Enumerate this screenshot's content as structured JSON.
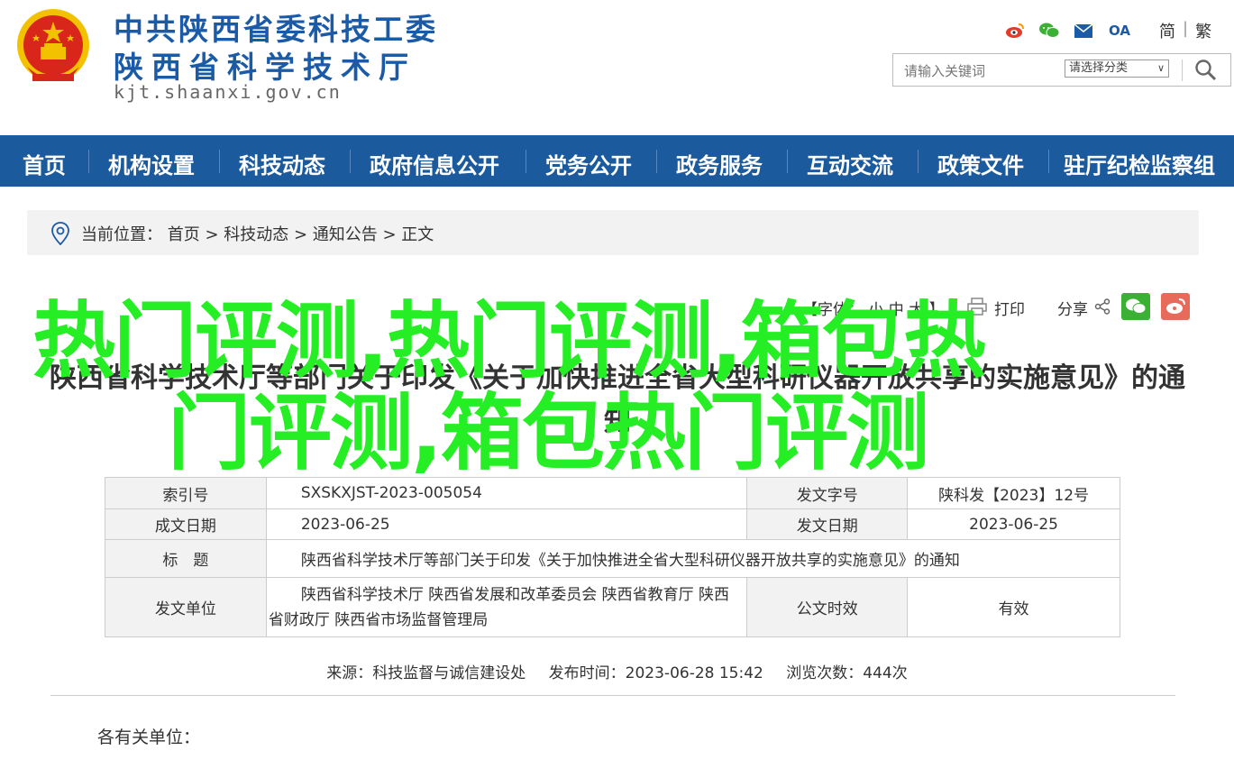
{
  "header": {
    "title_line1": "中共陕西省委科技工委",
    "title_line2": "陕西省科学技术厅",
    "domain": "kjt.shaanxi.gov.cn",
    "icons": [
      "weibo-icon",
      "wechat-icon",
      "mail-icon",
      "oa-icon"
    ],
    "oa_label": "OA",
    "lang_simplified": "简",
    "lang_separator": "|",
    "lang_traditional": "繁",
    "search_placeholder": "请输入关键词",
    "category_select": "请选择分类",
    "colors": {
      "brand_blue": "#1b5aa6",
      "emblem_red": "#d8261b",
      "emblem_gold": "#f2c200"
    }
  },
  "nav": {
    "items": [
      "首页",
      "机构设置",
      "科技动态",
      "政府信息公开",
      "党务公开",
      "政务服务",
      "互动交流",
      "政策文件",
      "驻厅纪检监察组"
    ],
    "background": "#1c5a9e"
  },
  "breadcrumb": {
    "text": "当前位置： 首页 > 科技动态 > 通知公告 > 正文"
  },
  "tools": {
    "font_size": "【字体： 小  中  大 】",
    "print": "打印",
    "share": "分享"
  },
  "article": {
    "title": "陕西省科学技术厅等部门关于印发《关于加快推进全省大型科研仪器开放共享的实施意见》的通知"
  },
  "overlay": {
    "line1": "热门评测,热门评测,箱包热",
    "line2": "门评测,箱包热门评测",
    "color": "#25ee24"
  },
  "info_table": {
    "index_label": "索引号",
    "index_value": "SXSKXJST-2023-005054",
    "doc_no_label": "发文字号",
    "doc_no_value": "陕科发【2023】12号",
    "created_label": "成文日期",
    "created_value": "2023-06-25",
    "issued_label": "发文日期",
    "issued_value": "2023-06-25",
    "subject_label": "标　题",
    "subject_value": "陕西省科学技术厅等部门关于印发《关于加快推进全省大型科研仪器开放共享的实施意见》的通知",
    "issuer_label": "发文单位",
    "issuer_value_line1": "陕西省科学技术厅 陕西省发展和改革委员会 陕西省教育厅 陕西",
    "issuer_value_line2": "省财政厅 陕西省市场监督管理局",
    "validity_label": "公文时效",
    "validity_value": "有效"
  },
  "meta": {
    "source": "来源：科技监督与诚信建设处",
    "published": "发布时间：2023-06-28 15:42",
    "views": "浏览次数：444次"
  },
  "body": {
    "salutation": "各有关单位："
  }
}
